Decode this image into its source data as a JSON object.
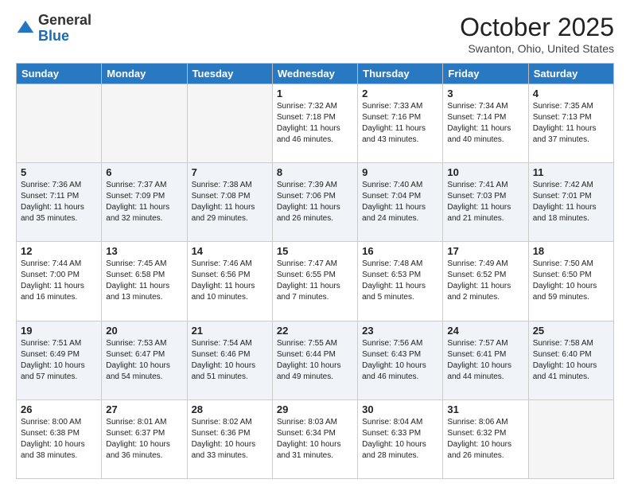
{
  "header": {
    "logo_general": "General",
    "logo_blue": "Blue",
    "month_title": "October 2025",
    "location": "Swanton, Ohio, United States"
  },
  "weekdays": [
    "Sunday",
    "Monday",
    "Tuesday",
    "Wednesday",
    "Thursday",
    "Friday",
    "Saturday"
  ],
  "weeks": [
    [
      {
        "day": "",
        "content": ""
      },
      {
        "day": "",
        "content": ""
      },
      {
        "day": "",
        "content": ""
      },
      {
        "day": "1",
        "content": "Sunrise: 7:32 AM\nSunset: 7:18 PM\nDaylight: 11 hours and 46 minutes."
      },
      {
        "day": "2",
        "content": "Sunrise: 7:33 AM\nSunset: 7:16 PM\nDaylight: 11 hours and 43 minutes."
      },
      {
        "day": "3",
        "content": "Sunrise: 7:34 AM\nSunset: 7:14 PM\nDaylight: 11 hours and 40 minutes."
      },
      {
        "day": "4",
        "content": "Sunrise: 7:35 AM\nSunset: 7:13 PM\nDaylight: 11 hours and 37 minutes."
      }
    ],
    [
      {
        "day": "5",
        "content": "Sunrise: 7:36 AM\nSunset: 7:11 PM\nDaylight: 11 hours and 35 minutes."
      },
      {
        "day": "6",
        "content": "Sunrise: 7:37 AM\nSunset: 7:09 PM\nDaylight: 11 hours and 32 minutes."
      },
      {
        "day": "7",
        "content": "Sunrise: 7:38 AM\nSunset: 7:08 PM\nDaylight: 11 hours and 29 minutes."
      },
      {
        "day": "8",
        "content": "Sunrise: 7:39 AM\nSunset: 7:06 PM\nDaylight: 11 hours and 26 minutes."
      },
      {
        "day": "9",
        "content": "Sunrise: 7:40 AM\nSunset: 7:04 PM\nDaylight: 11 hours and 24 minutes."
      },
      {
        "day": "10",
        "content": "Sunrise: 7:41 AM\nSunset: 7:03 PM\nDaylight: 11 hours and 21 minutes."
      },
      {
        "day": "11",
        "content": "Sunrise: 7:42 AM\nSunset: 7:01 PM\nDaylight: 11 hours and 18 minutes."
      }
    ],
    [
      {
        "day": "12",
        "content": "Sunrise: 7:44 AM\nSunset: 7:00 PM\nDaylight: 11 hours and 16 minutes."
      },
      {
        "day": "13",
        "content": "Sunrise: 7:45 AM\nSunset: 6:58 PM\nDaylight: 11 hours and 13 minutes."
      },
      {
        "day": "14",
        "content": "Sunrise: 7:46 AM\nSunset: 6:56 PM\nDaylight: 11 hours and 10 minutes."
      },
      {
        "day": "15",
        "content": "Sunrise: 7:47 AM\nSunset: 6:55 PM\nDaylight: 11 hours and 7 minutes."
      },
      {
        "day": "16",
        "content": "Sunrise: 7:48 AM\nSunset: 6:53 PM\nDaylight: 11 hours and 5 minutes."
      },
      {
        "day": "17",
        "content": "Sunrise: 7:49 AM\nSunset: 6:52 PM\nDaylight: 11 hours and 2 minutes."
      },
      {
        "day": "18",
        "content": "Sunrise: 7:50 AM\nSunset: 6:50 PM\nDaylight: 10 hours and 59 minutes."
      }
    ],
    [
      {
        "day": "19",
        "content": "Sunrise: 7:51 AM\nSunset: 6:49 PM\nDaylight: 10 hours and 57 minutes."
      },
      {
        "day": "20",
        "content": "Sunrise: 7:53 AM\nSunset: 6:47 PM\nDaylight: 10 hours and 54 minutes."
      },
      {
        "day": "21",
        "content": "Sunrise: 7:54 AM\nSunset: 6:46 PM\nDaylight: 10 hours and 51 minutes."
      },
      {
        "day": "22",
        "content": "Sunrise: 7:55 AM\nSunset: 6:44 PM\nDaylight: 10 hours and 49 minutes."
      },
      {
        "day": "23",
        "content": "Sunrise: 7:56 AM\nSunset: 6:43 PM\nDaylight: 10 hours and 46 minutes."
      },
      {
        "day": "24",
        "content": "Sunrise: 7:57 AM\nSunset: 6:41 PM\nDaylight: 10 hours and 44 minutes."
      },
      {
        "day": "25",
        "content": "Sunrise: 7:58 AM\nSunset: 6:40 PM\nDaylight: 10 hours and 41 minutes."
      }
    ],
    [
      {
        "day": "26",
        "content": "Sunrise: 8:00 AM\nSunset: 6:38 PM\nDaylight: 10 hours and 38 minutes."
      },
      {
        "day": "27",
        "content": "Sunrise: 8:01 AM\nSunset: 6:37 PM\nDaylight: 10 hours and 36 minutes."
      },
      {
        "day": "28",
        "content": "Sunrise: 8:02 AM\nSunset: 6:36 PM\nDaylight: 10 hours and 33 minutes."
      },
      {
        "day": "29",
        "content": "Sunrise: 8:03 AM\nSunset: 6:34 PM\nDaylight: 10 hours and 31 minutes."
      },
      {
        "day": "30",
        "content": "Sunrise: 8:04 AM\nSunset: 6:33 PM\nDaylight: 10 hours and 28 minutes."
      },
      {
        "day": "31",
        "content": "Sunrise: 8:06 AM\nSunset: 6:32 PM\nDaylight: 10 hours and 26 minutes."
      },
      {
        "day": "",
        "content": ""
      }
    ]
  ]
}
